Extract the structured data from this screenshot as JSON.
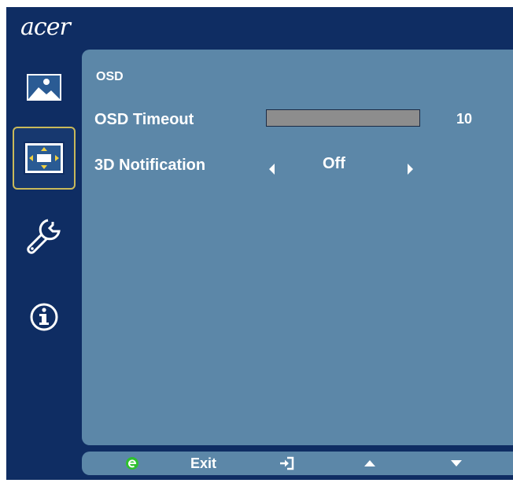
{
  "brand": {
    "logo_text": "acer"
  },
  "sidebar": {
    "items": [
      {
        "name": "picture",
        "icon": "landscape-picture-icon"
      },
      {
        "name": "osd",
        "icon": "osd-position-icon",
        "selected": true
      },
      {
        "name": "setting",
        "icon": "wrench-icon"
      },
      {
        "name": "information",
        "icon": "info-icon"
      }
    ]
  },
  "main": {
    "title": "OSD",
    "rows": [
      {
        "label": "OSD Timeout",
        "value": "10",
        "level_fraction": 0.0
      },
      {
        "label": "3D Notification",
        "value": "Off"
      }
    ]
  },
  "bottom_bar": {
    "exit_label": "Exit",
    "icons": [
      "empowering-e-icon",
      "enter-icon",
      "up-arrow-icon",
      "down-arrow-icon"
    ]
  },
  "colors": {
    "frame": "#0f2d63",
    "panel": "#5c87a8",
    "selection_border": "#c9b95a",
    "slider_fill": "#8d8d8d",
    "empowering_key": "#2fc02f"
  }
}
